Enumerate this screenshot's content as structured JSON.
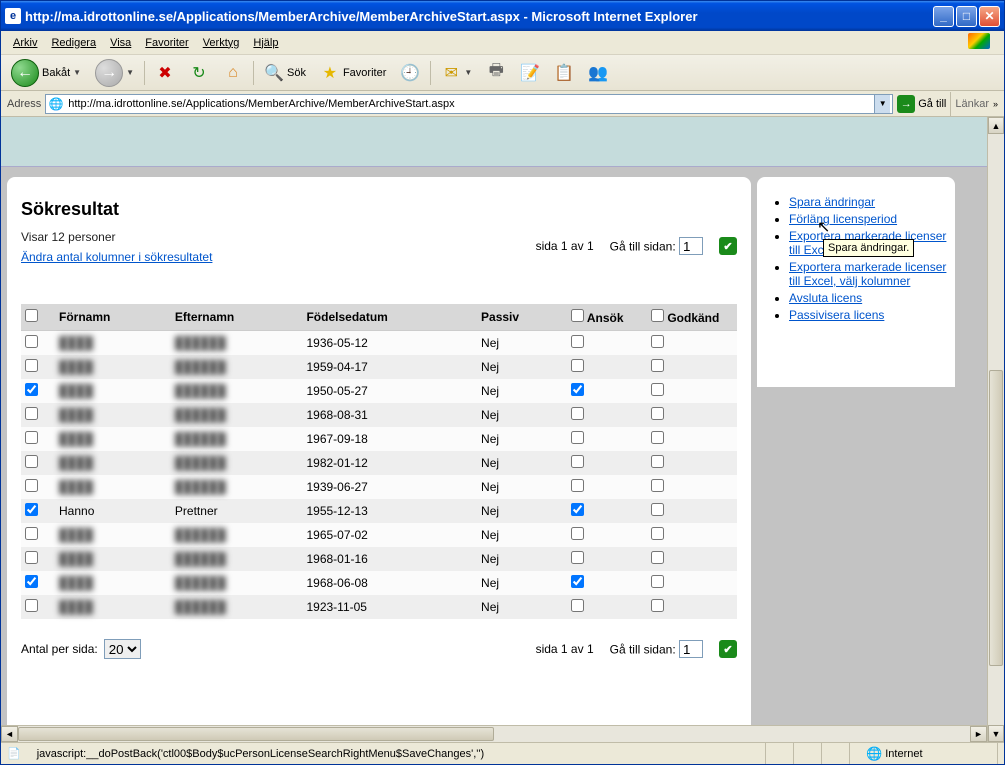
{
  "window": {
    "title": "http://ma.idrottonline.se/Applications/MemberArchive/MemberArchiveStart.aspx - Microsoft Internet Explorer"
  },
  "menubar": [
    "Arkiv",
    "Redigera",
    "Visa",
    "Favoriter",
    "Verktyg",
    "Hjälp"
  ],
  "toolbar": {
    "back": "Bakåt",
    "search": "Sök",
    "favorites": "Favoriter"
  },
  "addressbar": {
    "label": "Adress",
    "url": "http://ma.idrottonline.se/Applications/MemberArchive/MemberArchiveStart.aspx",
    "go": "Gå till",
    "links": "Länkar"
  },
  "main": {
    "title": "Sökresultat",
    "showing": "Visar 12 personer",
    "change_cols": "Ändra antal kolumner i sökresultatet",
    "page_info": "sida 1 av 1",
    "goto_page": "Gå till sidan:",
    "goto_value": "1",
    "per_page_label": "Antal per sida:",
    "per_page_value": "20",
    "headers": {
      "fornamn": "Förnamn",
      "efternamn": "Efternamn",
      "fodelsedatum": "Födelsedatum",
      "passiv": "Passiv",
      "ansok": "Ansök",
      "godkand": "Godkänd"
    },
    "rows": [
      {
        "sel": false,
        "fn": "████",
        "en": "██████",
        "fd": "1936-05-12",
        "passiv": "Nej",
        "ansok": false,
        "god": false,
        "blur": true
      },
      {
        "sel": false,
        "fn": "████",
        "en": "██████",
        "fd": "1959-04-17",
        "passiv": "Nej",
        "ansok": false,
        "god": false,
        "blur": true
      },
      {
        "sel": true,
        "fn": "████",
        "en": "██████",
        "fd": "1950-05-27",
        "passiv": "Nej",
        "ansok": true,
        "god": false,
        "blur": true
      },
      {
        "sel": false,
        "fn": "████",
        "en": "██████",
        "fd": "1968-08-31",
        "passiv": "Nej",
        "ansok": false,
        "god": false,
        "blur": true
      },
      {
        "sel": false,
        "fn": "████",
        "en": "██████",
        "fd": "1967-09-18",
        "passiv": "Nej",
        "ansok": false,
        "god": false,
        "blur": true
      },
      {
        "sel": false,
        "fn": "████",
        "en": "██████",
        "fd": "1982-01-12",
        "passiv": "Nej",
        "ansok": false,
        "god": false,
        "blur": true
      },
      {
        "sel": false,
        "fn": "████",
        "en": "██████",
        "fd": "1939-06-27",
        "passiv": "Nej",
        "ansok": false,
        "god": false,
        "blur": true
      },
      {
        "sel": true,
        "fn": "Hanno",
        "en": "Prettner",
        "fd": "1955-12-13",
        "passiv": "Nej",
        "ansok": true,
        "god": false,
        "blur": false
      },
      {
        "sel": false,
        "fn": "████",
        "en": "██████",
        "fd": "1965-07-02",
        "passiv": "Nej",
        "ansok": false,
        "god": false,
        "blur": true
      },
      {
        "sel": false,
        "fn": "████",
        "en": "██████",
        "fd": "1968-01-16",
        "passiv": "Nej",
        "ansok": false,
        "god": false,
        "blur": true
      },
      {
        "sel": true,
        "fn": "████",
        "en": "██████",
        "fd": "1968-06-08",
        "passiv": "Nej",
        "ansok": true,
        "god": false,
        "blur": true
      },
      {
        "sel": false,
        "fn": "████",
        "en": "██████",
        "fd": "1923-11-05",
        "passiv": "Nej",
        "ansok": false,
        "god": false,
        "blur": true
      }
    ]
  },
  "side": {
    "items": [
      "Spara ändringar",
      "Förläng licensperiod",
      "Exportera markerade licenser till Excel",
      "Exportera markerade licenser till Excel, välj kolumner",
      "Avsluta licens",
      "Passivisera licens"
    ],
    "tooltip": "Spara ändringar."
  },
  "statusbar": {
    "text": "javascript:__doPostBack('ctl00$Body$ucPersonLicenseSearchRightMenu$SaveChanges','')",
    "zone": "Internet"
  }
}
